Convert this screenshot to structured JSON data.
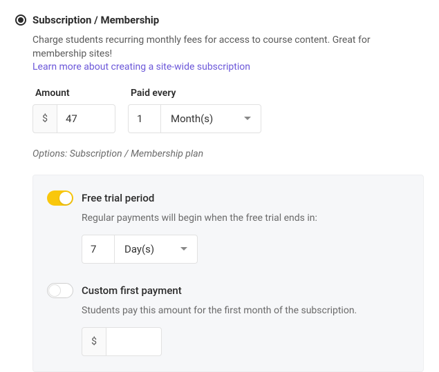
{
  "title": "Subscription / Membership",
  "description": "Charge students recurring monthly fees for access to course content. Great for membership sites!",
  "learn_more": "Learn more about creating a site-wide subscription",
  "amount": {
    "label": "Amount",
    "currency": "$",
    "value": "47"
  },
  "paid_every": {
    "label": "Paid every",
    "value": "1",
    "unit": "Month(s)"
  },
  "options_caption": "Options: Subscription / Membership plan",
  "free_trial": {
    "label": "Free trial period",
    "desc": "Regular payments will begin when the free trial ends in:",
    "value": "7",
    "unit": "Day(s)"
  },
  "custom_first": {
    "label": "Custom first payment",
    "desc": "Students pay this amount for the first month of the subscription.",
    "currency": "$",
    "value": ""
  }
}
